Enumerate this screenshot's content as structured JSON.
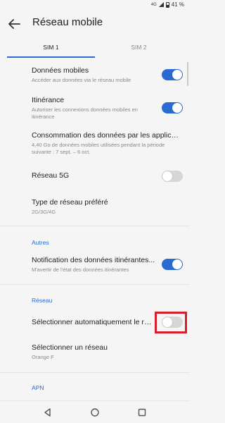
{
  "status": {
    "network": "4G",
    "battery": "41 %"
  },
  "appbar": {
    "title": "Réseau mobile"
  },
  "tabs": [
    {
      "label": "SIM 1",
      "selected": true
    },
    {
      "label": "SIM 2",
      "selected": false
    }
  ],
  "settings": {
    "mobile_data": {
      "title": "Données mobiles",
      "subtitle": "Accéder aux données via le réseau mobile",
      "enabled": true
    },
    "roaming": {
      "title": "Itinérance",
      "subtitle": "Autoriser les connexions données mobiles en itinérance",
      "enabled": true
    },
    "data_usage": {
      "title": "Consommation des données par les applicat...",
      "subtitle": "4,40 Go de données mobiles utilisées pendant la période suivante : 7 sept. – 6 oct."
    },
    "network_5g": {
      "title": "Réseau 5G",
      "enabled": false
    },
    "preferred_network": {
      "title": "Type de réseau préféré",
      "subtitle": "2G/3G/4G"
    }
  },
  "sections": {
    "others": {
      "header": "Autres",
      "roaming_notification": {
        "title": "Notification des données itinérantes...",
        "subtitle": "M'avertir de l'état des données itinérantes",
        "enabled": true
      }
    },
    "network": {
      "header": "Réseau",
      "auto_select": {
        "title": "Sélectionner automatiquement le ré...",
        "enabled": false
      },
      "select_network": {
        "title": "Sélectionner un réseau",
        "subtitle": "Orange F"
      }
    },
    "apn": {
      "header": "APN"
    }
  },
  "colors": {
    "accent": "#2a6bd1",
    "highlight": "#d71e2b"
  }
}
